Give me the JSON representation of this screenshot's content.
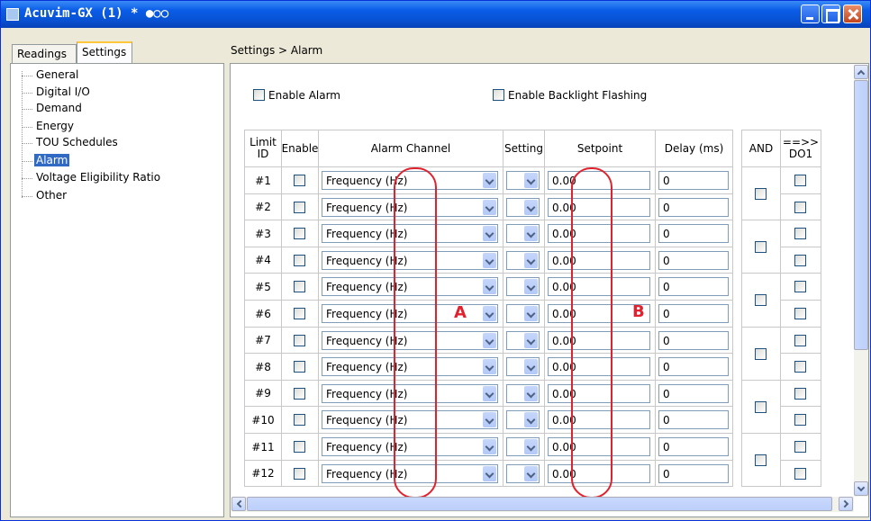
{
  "window": {
    "title": "Acuvim-GX (1) * ●○○"
  },
  "tabs": [
    {
      "label": "Readings"
    },
    {
      "label": "Settings"
    }
  ],
  "tree": {
    "items": [
      {
        "label": "General"
      },
      {
        "label": "Digital I/O"
      },
      {
        "label": "Demand"
      },
      {
        "label": "Energy"
      },
      {
        "label": "TOU Schedules"
      },
      {
        "label": "Alarm"
      },
      {
        "label": "Voltage Eligibility Ratio"
      },
      {
        "label": "Other"
      }
    ],
    "selected": "Alarm"
  },
  "breadcrumb": "Settings > Alarm",
  "options": {
    "enable_alarm": {
      "label": "Enable Alarm",
      "checked": false
    },
    "enable_backlight": {
      "label": "Enable Backlight Flashing",
      "checked": false
    }
  },
  "columns": {
    "limit_id": "Limit ID",
    "enable": "Enable",
    "alarm_channel": "Alarm Channel",
    "setting": "Setting",
    "setpoint": "Setpoint",
    "delay": "Delay (ms)",
    "and": "AND",
    "do1": "==>> DO1"
  },
  "rows": [
    {
      "id": "#1",
      "channel": "Frequency (Hz)",
      "setpoint": "0.00",
      "delay": "0"
    },
    {
      "id": "#2",
      "channel": "Frequency (Hz)",
      "setpoint": "0.00",
      "delay": "0"
    },
    {
      "id": "#3",
      "channel": "Frequency (Hz)",
      "setpoint": "0.00",
      "delay": "0"
    },
    {
      "id": "#4",
      "channel": "Frequency (Hz)",
      "setpoint": "0.00",
      "delay": "0"
    },
    {
      "id": "#5",
      "channel": "Frequency (Hz)",
      "setpoint": "0.00",
      "delay": "0"
    },
    {
      "id": "#6",
      "channel": "Frequency (Hz)",
      "setpoint": "0.00",
      "delay": "0"
    },
    {
      "id": "#7",
      "channel": "Frequency (Hz)",
      "setpoint": "0.00",
      "delay": "0"
    },
    {
      "id": "#8",
      "channel": "Frequency (Hz)",
      "setpoint": "0.00",
      "delay": "0"
    },
    {
      "id": "#9",
      "channel": "Frequency (Hz)",
      "setpoint": "0.00",
      "delay": "0"
    },
    {
      "id": "#10",
      "channel": "Frequency (Hz)",
      "setpoint": "0.00",
      "delay": "0"
    },
    {
      "id": "#11",
      "channel": "Frequency (Hz)",
      "setpoint": "0.00",
      "delay": "0"
    },
    {
      "id": "#12",
      "channel": "Frequency (Hz)",
      "setpoint": "0.00",
      "delay": "0"
    }
  ],
  "annotations": {
    "a": "A",
    "b": "B"
  },
  "colors": {
    "highlight": "#e0222e",
    "titlebar": "#0a5ce8",
    "selection": "#316ac5"
  }
}
